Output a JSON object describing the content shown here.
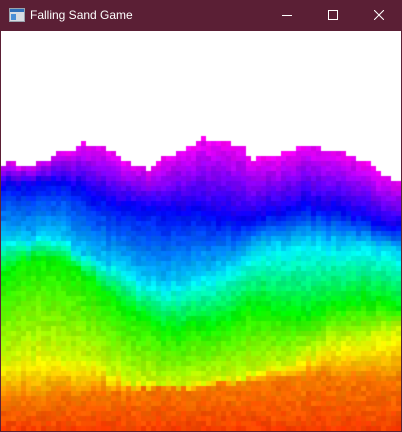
{
  "window": {
    "title": "Falling Sand Game",
    "frame_color": "#5b1f35",
    "title_color": "#ffffff",
    "controls": {
      "minimize_icon": "minimize-icon",
      "maximize_icon": "maximize-icon",
      "close_icon": "close-icon"
    }
  },
  "game": {
    "background": "#ffffff",
    "palette_order": [
      "orange",
      "yellow",
      "green",
      "cyan",
      "blue",
      "magenta"
    ]
  }
}
